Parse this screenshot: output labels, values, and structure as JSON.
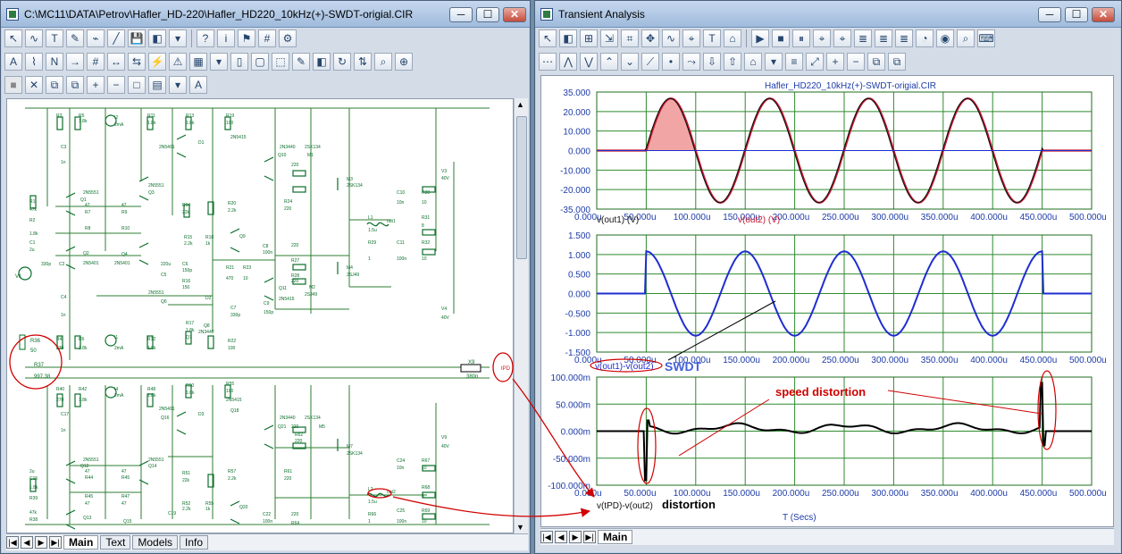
{
  "schematic_window": {
    "title": "C:\\MC11\\DATA\\Petrov\\Hafler_HD-220\\Hafler_HD220_10kHz(+)-SWDT-origial.CIR",
    "tabs": [
      "Main",
      "Text",
      "Models",
      "Info"
    ],
    "toolbar_row1": [
      "pointer",
      "wire",
      "text",
      "pen",
      "brush",
      "diagonal",
      "save",
      "component",
      "component-dropdown",
      "help",
      "info",
      "flag",
      "grid",
      "tools"
    ],
    "toolbar_row2": [
      "attr",
      "pinning",
      "node",
      "arrow",
      "node-number",
      "split",
      "join",
      "flash",
      "warning",
      "grid-lines",
      "dropdown",
      "page",
      "doc",
      "select-box",
      "edit",
      "mirror",
      "rotate",
      "flip",
      "find",
      "binoculars"
    ],
    "toolbar_row3": [
      "stop",
      "close",
      "copy",
      "copy2",
      "zoom-in",
      "zoom-out",
      "zoom-fit",
      "paste",
      "dropdown",
      "font"
    ],
    "labels": {
      "r36": "R36",
      "r36_value": "50",
      "r37": "R37",
      "r37_value": "997.38",
      "x9": "X9",
      "x9_value": "380n",
      "tpd": "tPD",
      "out1": "out1",
      "out2": "out2",
      "v3": "V3",
      "v3_value": "40V",
      "v4": "V4",
      "v4_value": "40V",
      "v8": "V8",
      "v8_value": "40V",
      "v9": "V9",
      "v9_value": "40V",
      "v1": "V1"
    }
  },
  "transient_window": {
    "title": "Transient Analysis",
    "tabs": [
      "Main"
    ],
    "toolbar_row1": [
      "pointer",
      "component",
      "zoom-region",
      "scale",
      "step",
      "pan",
      "trace",
      "cursor",
      "text",
      "tag",
      "run",
      "stop",
      "pause",
      "probe",
      "probe2",
      "list1",
      "list2",
      "list3",
      "cal",
      "fft",
      "zoom",
      "keys"
    ],
    "toolbar_row2": [
      "curves",
      "peak",
      "valley",
      "high",
      "low",
      "slope",
      "point",
      "inflect",
      "global-low",
      "global-high",
      "tag-mode",
      "dropdown",
      "legend",
      "fit",
      "zoom-in",
      "zoom-out",
      "copy",
      "copy2"
    ],
    "plot_title": "Hafler_HD220_10kHz(+)-SWDT-origial.CIR",
    "x_ticks": [
      "0.000u",
      "50.000u",
      "100.000u",
      "150.000u",
      "200.000u",
      "250.000u",
      "300.000u",
      "350.000u",
      "400.000u",
      "450.000u",
      "500.000u"
    ],
    "x_axis_label": "T (Secs)",
    "plot1": {
      "y_ticks": [
        "35.000",
        "20.000",
        "10.000",
        "0.000",
        "-10.000",
        "-20.000",
        "-35.000"
      ],
      "trace1": "v(out1) (V)",
      "trace2": "v(out2) (V)"
    },
    "plot2": {
      "y_ticks": [
        "1.500",
        "1.000",
        "0.500",
        "0.000",
        "-0.500",
        "-1.000",
        "-1.500"
      ],
      "trace": "v(out1)-v(out2)",
      "annotation": "SWDT"
    },
    "plot3": {
      "y_ticks": [
        "100.000m",
        "50.000m",
        "0.000m",
        "-50.000m",
        "-100.000m"
      ],
      "trace": "v(tPD)-v(out2)",
      "annotation_distortion": "distortion",
      "annotation_speed": "speed distortion"
    },
    "colors": {
      "out1": "#c5162f",
      "out2": "#111111",
      "swdt": "#1f2ecf",
      "annotation_red": "#d10000",
      "grid": "#2f8b2f"
    }
  }
}
